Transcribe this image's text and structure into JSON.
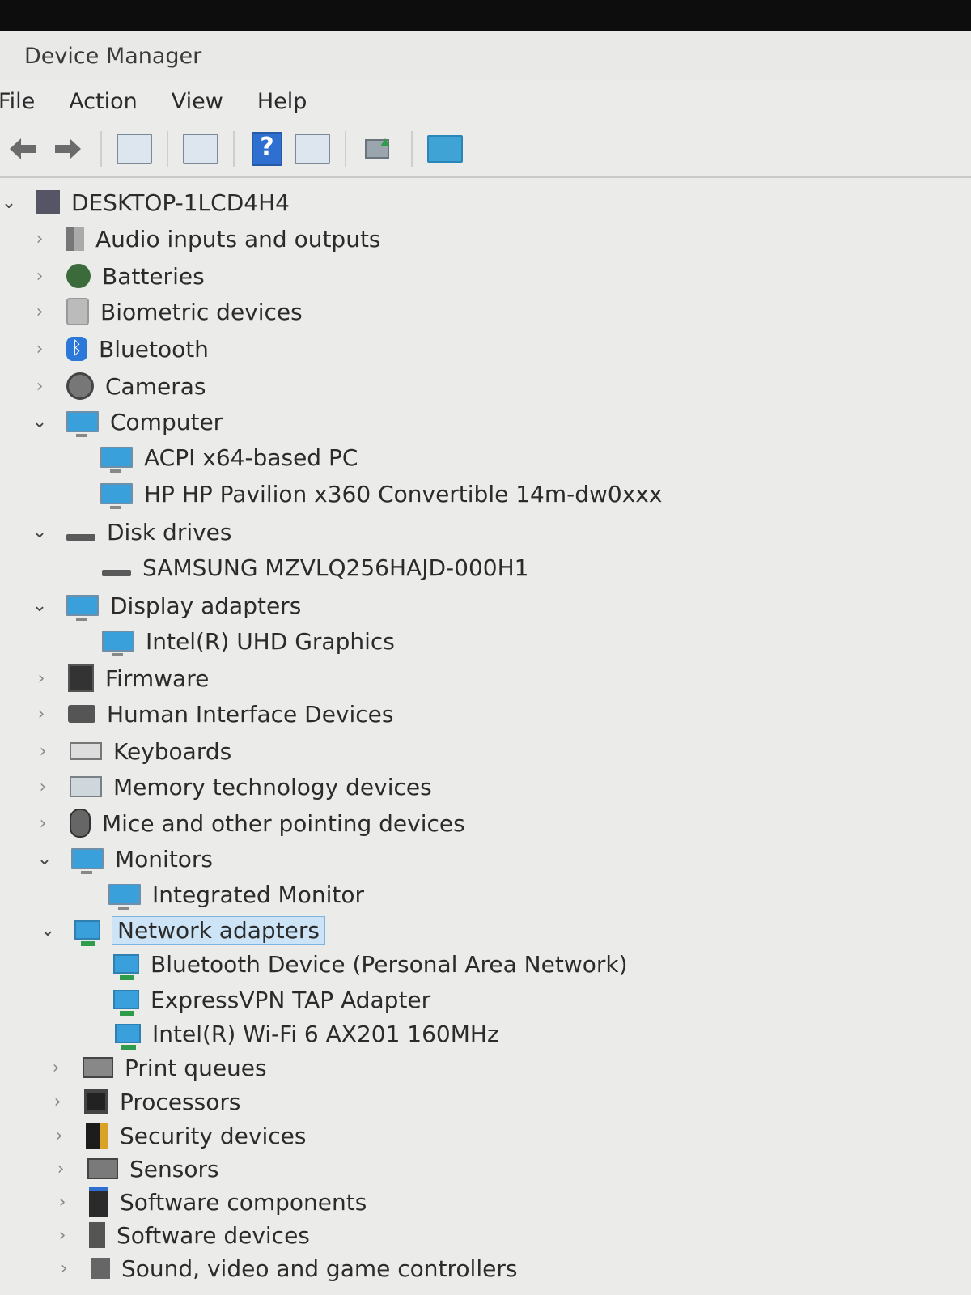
{
  "window": {
    "title": "Device Manager"
  },
  "menu": {
    "items": [
      "File",
      "Action",
      "View",
      "Help"
    ]
  },
  "toolbar": {
    "buttons": [
      "back-icon",
      "forward-icon",
      "show-hide-console-tree-icon",
      "properties-icon",
      "help-icon",
      "action-pane-icon",
      "update-driver-icon",
      "scan-hardware-icon"
    ]
  },
  "tree": {
    "root": "DESKTOP-1LCD4H4",
    "items": [
      {
        "label": "Audio inputs and outputs",
        "icon": "speaker-icon",
        "expanded": false
      },
      {
        "label": "Batteries",
        "icon": "battery-icon",
        "expanded": false
      },
      {
        "label": "Biometric devices",
        "icon": "fingerprint-icon",
        "expanded": false
      },
      {
        "label": "Bluetooth",
        "icon": "bluetooth-icon",
        "expanded": false
      },
      {
        "label": "Cameras",
        "icon": "camera-icon",
        "expanded": false
      },
      {
        "label": "Computer",
        "icon": "monitor-icon",
        "expanded": true
      },
      {
        "label": "ACPI x64-based PC",
        "icon": "monitor-icon",
        "child": true
      },
      {
        "label": "HP HP Pavilion x360 Convertible 14m-dw0xxx",
        "icon": "monitor-icon",
        "child": true
      },
      {
        "label": "Disk drives",
        "icon": "disk-icon",
        "expanded": true
      },
      {
        "label": "SAMSUNG MZVLQ256HAJD-000H1",
        "icon": "disk-icon",
        "child": true
      },
      {
        "label": "Display adapters",
        "icon": "display-adapter-icon",
        "expanded": true
      },
      {
        "label": "Intel(R) UHD Graphics",
        "icon": "display-adapter-icon",
        "child": true
      },
      {
        "label": "Firmware",
        "icon": "chip-icon",
        "expanded": false
      },
      {
        "label": "Human Interface Devices",
        "icon": "hid-icon",
        "expanded": false
      },
      {
        "label": "Keyboards",
        "icon": "keyboard-icon",
        "expanded": false
      },
      {
        "label": "Memory technology devices",
        "icon": "memory-icon",
        "expanded": false
      },
      {
        "label": "Mice and other pointing devices",
        "icon": "mouse-icon",
        "expanded": false
      },
      {
        "label": "Monitors",
        "icon": "monitor-icon",
        "expanded": true
      },
      {
        "label": "Integrated Monitor",
        "icon": "monitor-icon",
        "child": true
      },
      {
        "label": "Network adapters",
        "icon": "network-icon",
        "expanded": true,
        "selected": true
      },
      {
        "label": "Bluetooth Device (Personal Area Network)",
        "icon": "network-icon",
        "child": true
      },
      {
        "label": "ExpressVPN TAP Adapter",
        "icon": "network-icon",
        "child": true
      },
      {
        "label": "Intel(R) Wi-Fi 6 AX201 160MHz",
        "icon": "network-icon",
        "child": true
      },
      {
        "label": "Print queues",
        "icon": "printer-icon",
        "expanded": false
      },
      {
        "label": "Processors",
        "icon": "cpu-icon",
        "expanded": false
      },
      {
        "label": "Security devices",
        "icon": "security-icon",
        "expanded": false
      },
      {
        "label": "Sensors",
        "icon": "sensor-icon",
        "expanded": false
      },
      {
        "label": "Software components",
        "icon": "software-component-icon",
        "expanded": false
      },
      {
        "label": "Software devices",
        "icon": "software-device-icon",
        "expanded": false
      },
      {
        "label": "Sound, video and game controllers",
        "icon": "sound-icon",
        "expanded": false
      }
    ]
  }
}
